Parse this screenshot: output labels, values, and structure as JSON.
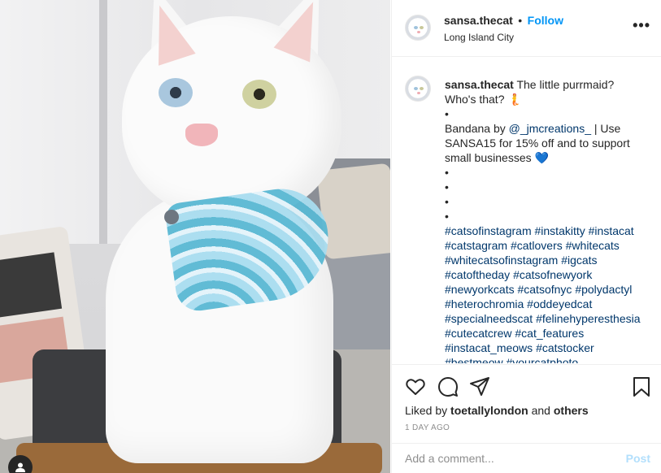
{
  "post": {
    "username": "sansa.thecat",
    "separator": "•",
    "follow_label": "Follow",
    "location": "Long Island City",
    "more_icon": "more-options-icon",
    "more_label": "•••"
  },
  "caption": {
    "username": "sansa.thecat",
    "line1": " The little purrmaid? Who's that? ",
    "emoji1": "🧜",
    "bullet": "•",
    "bandana_prefix": "Bandana by ",
    "mention": "@_jmcreations_",
    "bandana_suffix": " | Use SANSA15 for 15% off and to support small businesses ",
    "emoji2": "💙",
    "hashtags": [
      "#catsofinstagram",
      "#instakitty",
      "#instacat",
      "#catstagram",
      "#catlovers",
      "#whitecats",
      "#whitecatsofinstagram",
      "#igcats",
      "#catoftheday",
      "#catsofnewyork",
      "#newyorkcats",
      "#catsofnyc",
      "#polydactyl",
      "#heterochromia",
      "#oddeyedcat",
      "#specialneedscat",
      "#felinehyperesthesia",
      "#cutecatcrew",
      "#cat_features",
      "#instacat_meows",
      "#catstocker",
      "#bestmeow",
      "#yourcatphoto"
    ]
  },
  "actions": {
    "liked_prefix": "Liked by ",
    "liked_user": "toetallylondon",
    "liked_and": " and ",
    "liked_others": "others",
    "timestamp": "1 DAY AGO"
  },
  "comment": {
    "placeholder": "Add a comment...",
    "post_label": "Post"
  },
  "colors": {
    "accent": "#0095f6",
    "hashtag": "#00376b",
    "post_disabled": "#b2dffc"
  }
}
